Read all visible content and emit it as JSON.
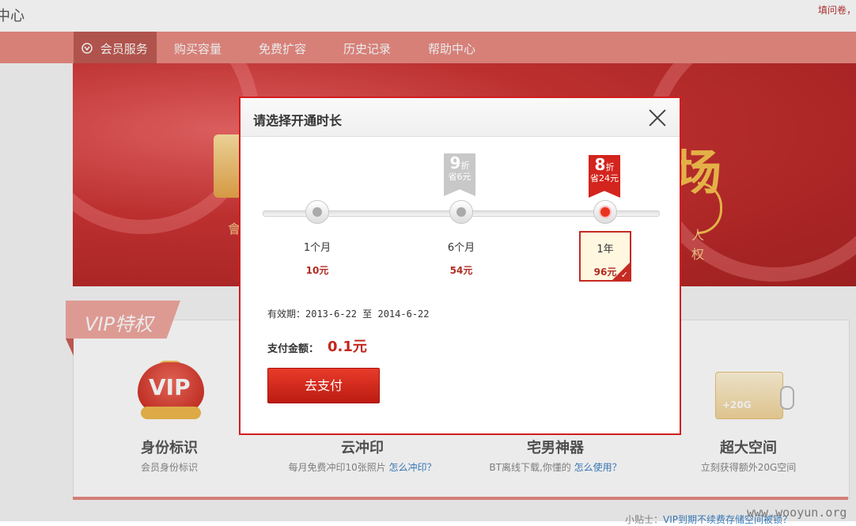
{
  "header": {
    "site_title": "i中心",
    "top_links": "填问卷，"
  },
  "nav": {
    "items": [
      {
        "label": "会员服务",
        "icon": "vip-icon"
      },
      {
        "label": "购买容量"
      },
      {
        "label": "免费扩容"
      },
      {
        "label": "历史记录"
      },
      {
        "label": "帮助中心"
      }
    ]
  },
  "banner": {
    "glyph": "场",
    "text_left": "會",
    "text_right_1": "人",
    "text_right_2": "权"
  },
  "vip_section": {
    "tab_label": "VIP特权",
    "features": [
      {
        "title": "身份标识",
        "desc": "会员身份标识",
        "icon": "vip-badge-icon"
      },
      {
        "title": "云冲印",
        "desc": "每月免费冲印10张照片",
        "link": "怎么冲印？"
      },
      {
        "title": "宅男神器",
        "desc": "BT离线下载,你懂的",
        "link": "怎么使用？"
      },
      {
        "title": "超大空间",
        "desc": "立刻获得额外20G空间",
        "icon": "storage-card-icon",
        "card_text": "+20G"
      }
    ]
  },
  "dialog": {
    "title": "请选择开通时长",
    "close_icon": "close-icon",
    "options": [
      {
        "duration": "1个月",
        "price": "10元"
      },
      {
        "duration": "6个月",
        "price": "54元",
        "discount": "9",
        "zhe": "折",
        "save": "省6元"
      },
      {
        "duration": "1年",
        "price": "96元",
        "discount": "8",
        "zhe": "折",
        "save": "省24元",
        "selected": true
      }
    ],
    "validity": "有效期：2013-6-22 至 2014-6-22",
    "amount_label": "支付金额：",
    "amount_value": "0.1元",
    "pay_button": "去支付"
  },
  "footer": {
    "tip_prefix": "小贴士：",
    "tip_link": "VIP到期不续费存储空间被锁？",
    "watermark": "www.wooyun.org"
  },
  "colors": {
    "accent": "#d11e1e",
    "nav_bg": "#e98b83",
    "nav_active": "#bf5b53"
  }
}
